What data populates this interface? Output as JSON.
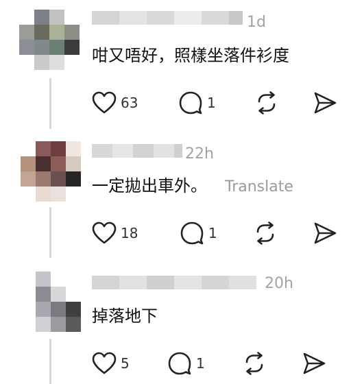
{
  "comments": [
    {
      "timestamp": "1d",
      "text": "咁又唔好，照樣坐落件衫度",
      "likes": "63",
      "replies": "1",
      "translate": ""
    },
    {
      "timestamp": "22h",
      "text": "一定拋出車外。",
      "likes": "18",
      "replies": "1",
      "translate": "Translate"
    },
    {
      "timestamp": "20h",
      "text": "掉落地下",
      "likes": "5",
      "replies": "1",
      "translate": ""
    }
  ],
  "icons": {
    "like": "heart-icon",
    "reply": "comment-bubble-icon",
    "repost": "repost-icon",
    "share": "send-icon"
  },
  "colors": {
    "text": "#111111",
    "muted": "#a3a3a3",
    "thread_line": "#d6d6d6"
  }
}
